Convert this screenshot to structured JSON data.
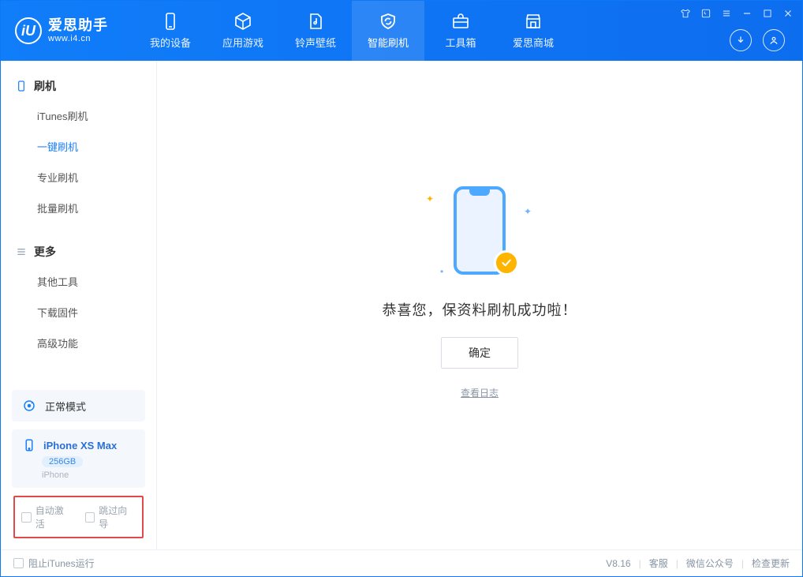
{
  "app": {
    "title": "爱思助手",
    "subtitle": "www.i4.cn"
  },
  "nav": {
    "items": [
      {
        "label": "我的设备"
      },
      {
        "label": "应用游戏"
      },
      {
        "label": "铃声壁纸"
      },
      {
        "label": "智能刷机"
      },
      {
        "label": "工具箱"
      },
      {
        "label": "爱思商城"
      }
    ]
  },
  "sidebar": {
    "section1": {
      "title": "刷机",
      "items": [
        {
          "label": "iTunes刷机"
        },
        {
          "label": "一键刷机"
        },
        {
          "label": "专业刷机"
        },
        {
          "label": "批量刷机"
        }
      ]
    },
    "section2": {
      "title": "更多",
      "items": [
        {
          "label": "其他工具"
        },
        {
          "label": "下载固件"
        },
        {
          "label": "高级功能"
        }
      ]
    },
    "mode_card": {
      "label": "正常模式"
    },
    "device_card": {
      "name": "iPhone XS Max",
      "storage": "256GB",
      "type": "iPhone"
    },
    "options": {
      "auto_activate": "自动激活",
      "skip_guide": "跳过向导"
    }
  },
  "main": {
    "message": "恭喜您，保资料刷机成功啦！",
    "confirm_label": "确定",
    "log_link": "查看日志"
  },
  "status": {
    "block_itunes": "阻止iTunes运行",
    "version": "V8.16",
    "links": {
      "service": "客服",
      "wechat": "微信公众号",
      "update": "检查更新"
    }
  }
}
